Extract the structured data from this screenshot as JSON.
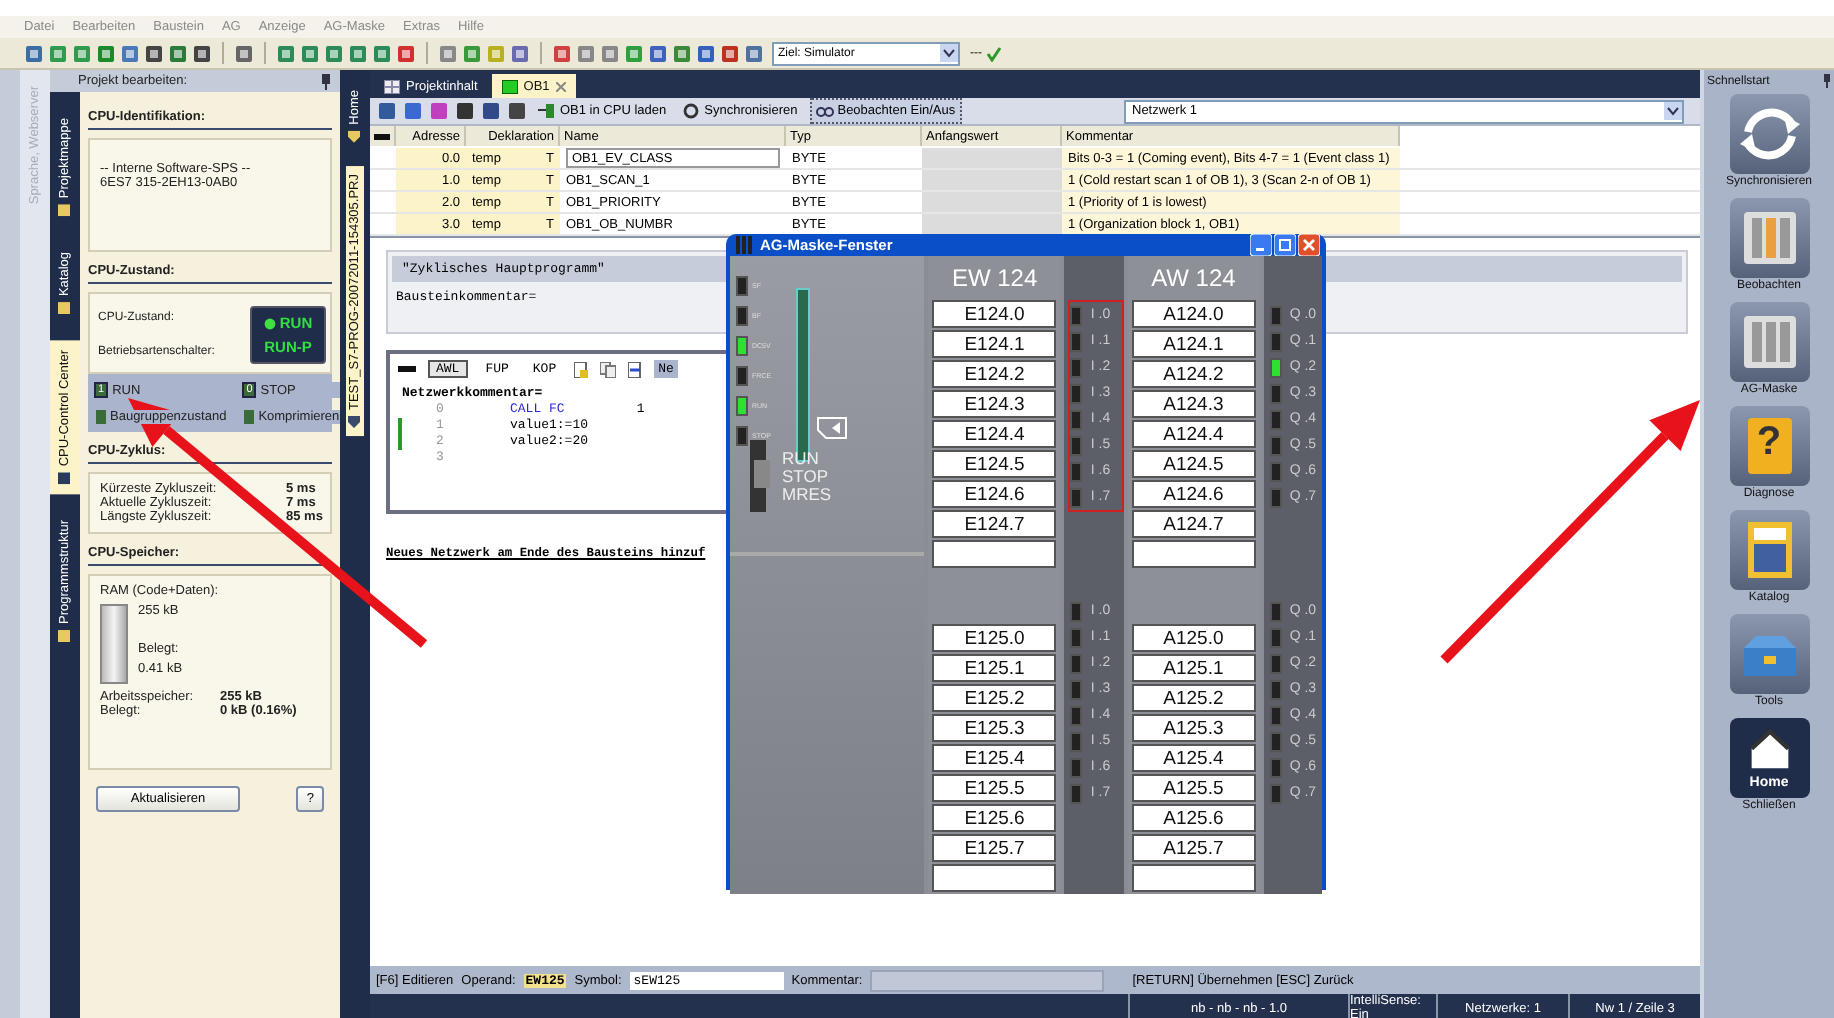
{
  "menu": [
    "Datei",
    "Bearbeiten",
    "Baustein",
    "AG",
    "Anzeige",
    "AG-Maske",
    "Extras",
    "Hilfe"
  ],
  "toolbar": {
    "target": "Ziel: Simulator",
    "more": "---"
  },
  "outer_tabs": [
    {
      "label": "Sprache, Webserver",
      "disabled": true
    }
  ],
  "left_panel": {
    "title": "Projekt bearbeiten:",
    "tabs": [
      {
        "label": "Projektmappe",
        "selected": false
      },
      {
        "label": "Katalog",
        "selected": false
      },
      {
        "label": "CPU-Control Center",
        "selected": true
      },
      {
        "label": "Programmstruktur",
        "selected": false
      }
    ],
    "cpu_identification": {
      "heading": "CPU-Identifikation:",
      "lines": [
        "-- Interne Software-SPS --",
        "6ES7 315-2EH13-0AB0"
      ]
    },
    "cpu_state": {
      "heading": "CPU-Zustand:",
      "labels": [
        "CPU-Zustand:",
        "Betriebsartenschalter:"
      ],
      "display": [
        "RUN",
        "RUN-P"
      ],
      "led_on": true,
      "actions": [
        {
          "icon_text": "1",
          "label": "RUN"
        },
        {
          "icon_text": "0",
          "label": "STOP"
        },
        {
          "label": "Baugruppenzustand"
        },
        {
          "label": "Komprimieren"
        }
      ]
    },
    "cpu_cycle": {
      "heading": "CPU-Zyklus:",
      "rows": [
        {
          "label": "Kürzeste Zykluszeit:",
          "value": "5 ms"
        },
        {
          "label": "Aktuelle Zykluszeit:",
          "value": "7 ms"
        },
        {
          "label": "Längste Zykluszeit:",
          "value": "85 ms"
        }
      ]
    },
    "cpu_memory": {
      "heading": "CPU-Speicher:",
      "ram_label": "RAM (Code+Daten):",
      "level": 0.0016,
      "total": "255 kB",
      "used_label": "Belegt:",
      "used": "0.41 kB",
      "rows": [
        {
          "label": "Arbeitsspeicher:",
          "value": "255 kB"
        },
        {
          "label": "Belegt:",
          "value": "0 kB (0.16%)"
        }
      ]
    },
    "buttons": [
      "Aktualisieren",
      "?"
    ]
  },
  "project_tabs": [
    {
      "label": "Home",
      "selected": false
    },
    {
      "label": "TEST_S7-PROG-20072011-154305.PRJ",
      "selected": true
    }
  ],
  "doc_tabs": [
    {
      "label": "Projektinhalt",
      "selected": false
    },
    {
      "label": "OB1",
      "selected": true
    }
  ],
  "editor_toolbar": [
    {
      "label": "OB1 in CPU laden",
      "kind": "load",
      "on": false
    },
    {
      "label": "Synchronisieren",
      "kind": "sync",
      "on": false
    },
    {
      "label": "Beobachten Ein/Aus",
      "kind": "watch",
      "on": true
    }
  ],
  "network_select": "Netzwerk 1",
  "table": {
    "columns": [
      "Adresse",
      "Deklaration",
      "Name",
      "Typ",
      "Anfangswert",
      "Kommentar"
    ],
    "rows": [
      {
        "address": "0.0",
        "declaration": "temp",
        "flag": "T",
        "name": "OB1_EV_CLASS",
        "type": "BYTE",
        "comment": "Bits 0-3 = 1 (Coming event), Bits 4-7 = 1 (Event class 1)",
        "selected": true
      },
      {
        "address": "1.0",
        "declaration": "temp",
        "flag": "T",
        "name": "OB1_SCAN_1",
        "type": "BYTE",
        "comment": "1 (Cold restart scan 1 of OB 1), 3 (Scan 2-n of OB 1)",
        "selected": false
      },
      {
        "address": "2.0",
        "declaration": "temp",
        "flag": "T",
        "name": "OB1_PRIORITY",
        "type": "BYTE",
        "comment": "1 (Priority of 1 is lowest)",
        "selected": false
      },
      {
        "address": "3.0",
        "declaration": "temp",
        "flag": "T",
        "name": "OB1_OB_NUMBR",
        "type": "BYTE",
        "comment": "1 (Organization block 1, OB1)",
        "selected": false
      }
    ]
  },
  "block": {
    "title": "\"Zyklisches Hauptprogramm\"",
    "comment_label": "Bausteinkommentar=",
    "network": {
      "views": [
        {
          "label": "AWL",
          "selected": true
        },
        {
          "label": "FUP",
          "selected": false
        },
        {
          "label": "KOP",
          "selected": false
        }
      ],
      "extra_button": "Ne",
      "comment_label": "Netzwerkkommentar=",
      "lines": [
        {
          "number": "0",
          "code": "CALL FC",
          "arg": "1",
          "marked": false
        },
        {
          "number": "1",
          "code": "value1:=10",
          "marked": true
        },
        {
          "number": "2",
          "code": "value2:=20",
          "marked": true
        },
        {
          "number": "3",
          "marked": false
        }
      ]
    },
    "add_network": "Neues Netzwerk am Ende des Bausteins hinzuf"
  },
  "status": {
    "mode": "[F6] Editieren",
    "operand_label": "Operand:",
    "operand": "EW125",
    "symbol_label": "Symbol:",
    "symbol": "sEW125",
    "comment_label": "Kommentar:",
    "hint": "[RETURN] Übernehmen [ESC] Zurück",
    "cells": [
      "nb - nb - nb - 1.0",
      "IntelliSense: Ein",
      "Netzwerke: 1",
      "Nw 1 / Zeile 3"
    ]
  },
  "quickstart": {
    "title": "Schnellstart",
    "items": [
      {
        "label": "Synchronisieren",
        "kind": "sync"
      },
      {
        "label": "Beobachten",
        "kind": "watch"
      },
      {
        "label": "AG-Maske",
        "kind": "plc"
      },
      {
        "label": "Diagnose",
        "kind": "help",
        "icon_text": "?"
      },
      {
        "label": "Katalog",
        "kind": "catalog"
      },
      {
        "label": "Tools",
        "kind": "tools"
      },
      {
        "label": "Schließen",
        "kind": "home",
        "icon_text": "Home"
      }
    ]
  },
  "plc_window": {
    "title": "AG-Maske-Fenster",
    "cpu_leds": [
      {
        "label": "SF",
        "on": false
      },
      {
        "label": "BF",
        "on": false
      },
      {
        "label": "DC5V",
        "on": true
      },
      {
        "label": "FRCE",
        "on": false
      },
      {
        "label": "RUN",
        "on": true
      },
      {
        "label": "STOP",
        "on": false
      }
    ],
    "switch": [
      "RUN",
      "STOP",
      "MRES"
    ],
    "modules": [
      {
        "title": "EW 124",
        "groups": [
          {
            "highlighted": true,
            "channels": [
              {
                "label": "E124.0",
                "led": "I .0",
                "on": false
              },
              {
                "label": "E124.1",
                "led": "I .1",
                "on": false
              },
              {
                "label": "E124.2",
                "led": "I .2",
                "on": false
              },
              {
                "label": "E124.3",
                "led": "I .3",
                "on": false
              },
              {
                "label": "E124.4",
                "led": "I .4",
                "on": false
              },
              {
                "label": "E124.5",
                "led": "I .5",
                "on": false
              },
              {
                "label": "E124.6",
                "led": "I .6",
                "on": false
              },
              {
                "label": "E124.7",
                "led": "I .7",
                "on": false
              }
            ]
          },
          {
            "highlighted": false,
            "channels": [
              {
                "label": "E125.0",
                "led": "I .0",
                "on": false
              },
              {
                "label": "E125.1",
                "led": "I .1",
                "on": false
              },
              {
                "label": "E125.2",
                "led": "I .2",
                "on": false
              },
              {
                "label": "E125.3",
                "led": "I .3",
                "on": false
              },
              {
                "label": "E125.4",
                "led": "I .4",
                "on": false
              },
              {
                "label": "E125.5",
                "led": "I .5",
                "on": false
              },
              {
                "label": "E125.6",
                "led": "I .6",
                "on": false
              },
              {
                "label": "E125.7",
                "led": "I .7",
                "on": false
              }
            ]
          }
        ]
      },
      {
        "title": "AW 124",
        "groups": [
          {
            "highlighted": false,
            "channels": [
              {
                "label": "A124.0",
                "led": "Q .0",
                "on": false
              },
              {
                "label": "A124.1",
                "led": "Q .1",
                "on": false
              },
              {
                "label": "A124.2",
                "led": "Q .2",
                "on": true
              },
              {
                "label": "A124.3",
                "led": "Q .3",
                "on": false
              },
              {
                "label": "A124.4",
                "led": "Q .4",
                "on": false
              },
              {
                "label": "A124.5",
                "led": "Q .5",
                "on": false
              },
              {
                "label": "A124.6",
                "led": "Q .6",
                "on": false
              },
              {
                "label": "A124.7",
                "led": "Q .7",
                "on": false
              }
            ]
          },
          {
            "highlighted": false,
            "channels": [
              {
                "label": "A125.0",
                "led": "Q .0",
                "on": false
              },
              {
                "label": "A125.1",
                "led": "Q .1",
                "on": false
              },
              {
                "label": "A125.2",
                "led": "Q .2",
                "on": false
              },
              {
                "label": "A125.3",
                "led": "Q .3",
                "on": false
              },
              {
                "label": "A125.4",
                "led": "Q .4",
                "on": false
              },
              {
                "label": "A125.5",
                "led": "Q .5",
                "on": false
              },
              {
                "label": "A125.6",
                "led": "Q .6",
                "on": false
              },
              {
                "label": "A125.7",
                "led": "Q .7",
                "on": false
              }
            ]
          }
        ]
      }
    ]
  }
}
